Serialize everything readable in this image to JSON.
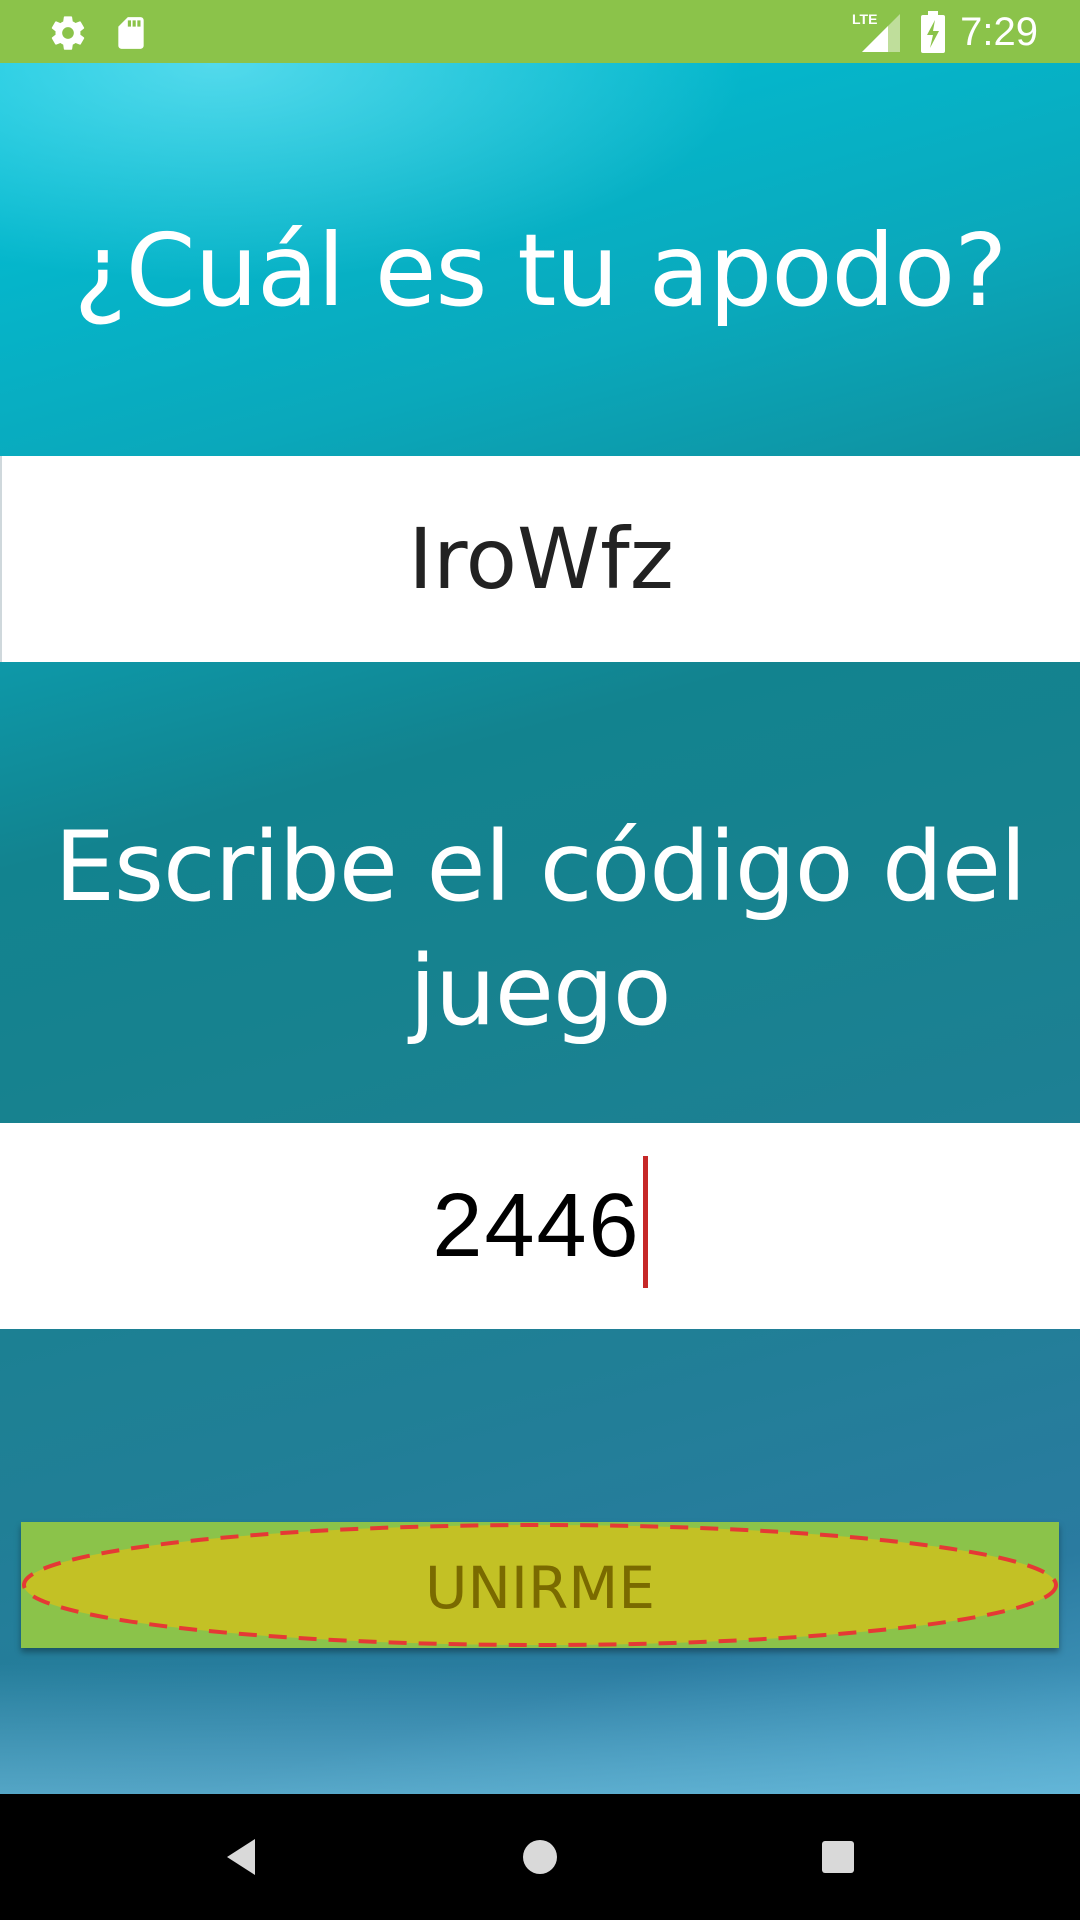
{
  "status_bar": {
    "time": "7:29",
    "network_type": "LTE",
    "icons": [
      "settings-icon",
      "sd-card-icon",
      "signal-icon",
      "battery-charging-icon"
    ]
  },
  "nickname": {
    "title": "¿Cuál es tu apodo?",
    "value": "IroWfz"
  },
  "game_code": {
    "title": "Escribe el código del juego",
    "value": "2446"
  },
  "join_button": {
    "label": "UNIRME"
  },
  "navigation": {
    "icons": [
      "back-icon",
      "home-icon",
      "recents-icon"
    ]
  },
  "colors": {
    "status_bar": "#8bc34a",
    "button_bg": "#8bc34a",
    "button_oval": "#c3c125",
    "button_text": "#7a6a00",
    "oval_outline": "#e53935",
    "caret": "#c62828"
  }
}
